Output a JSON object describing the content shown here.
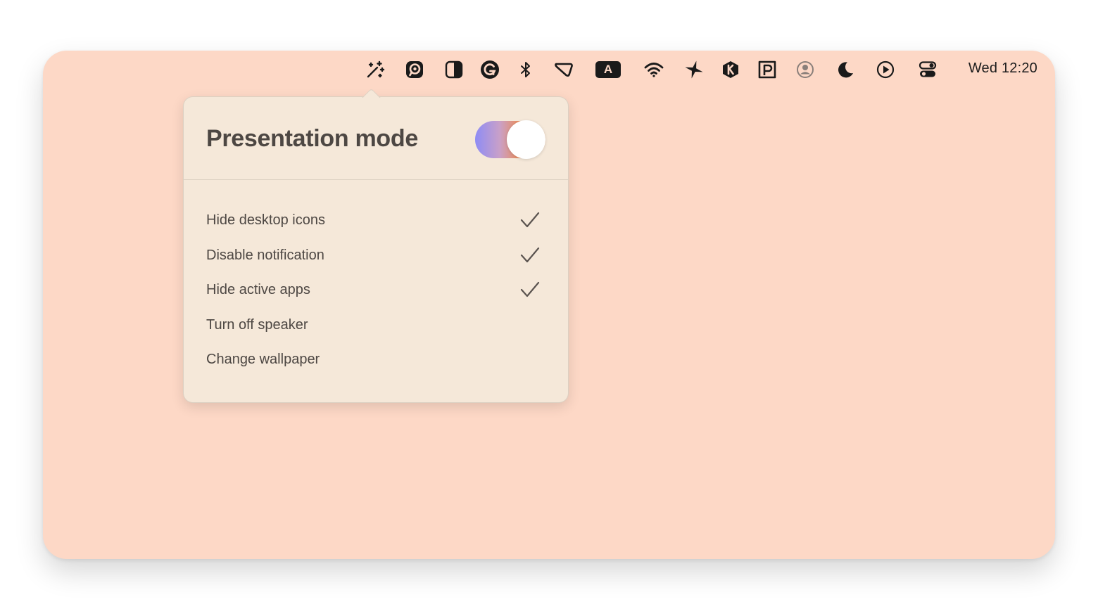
{
  "menubar": {
    "icons": [
      "magic-wand-icon",
      "pastebot-icon",
      "contrast-icon",
      "grammarly-icon",
      "bluetooth-icon",
      "command-tag-icon",
      "keyboard-input-icon",
      "wifi-icon",
      "sparkle-plus-icon",
      "k-app-icon",
      "p-app-icon",
      "user-account-icon",
      "moon-icon",
      "play-circle-icon",
      "control-center-icon"
    ],
    "keyboard_input_letter": "A",
    "clock": "Wed 12:20"
  },
  "popover": {
    "title": "Presentation mode",
    "toggle_on": true,
    "toggle_gradient": [
      "#8e8cf5",
      "#f07a2e"
    ],
    "options": [
      {
        "label": "Hide desktop icons",
        "checked": true
      },
      {
        "label": "Disable notification",
        "checked": true
      },
      {
        "label": "Hide active apps",
        "checked": true
      },
      {
        "label": "Turn off speaker",
        "checked": false
      },
      {
        "label": "Change wallpaper",
        "checked": false
      }
    ]
  },
  "colors": {
    "desktop": "#fdd8c6",
    "popover": "#f5e8d9",
    "text": "#4d4743"
  }
}
